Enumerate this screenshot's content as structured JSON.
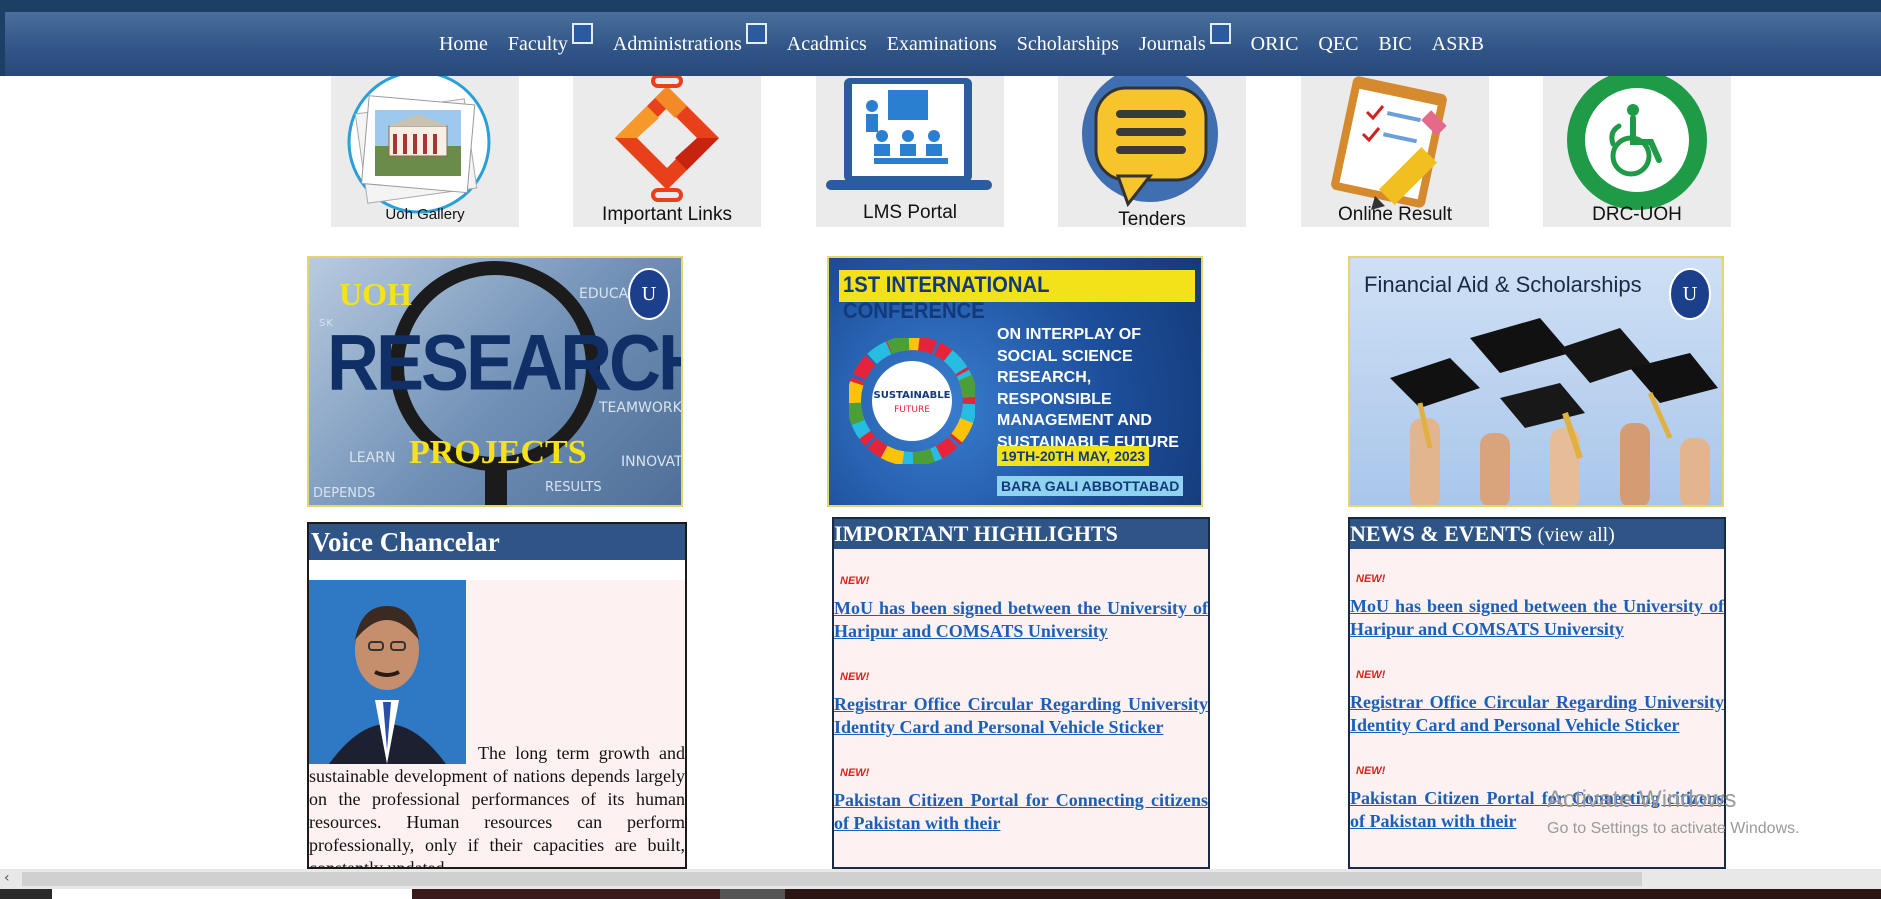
{
  "nav": {
    "items": [
      "Home",
      "Faculty",
      "Administrations",
      "Acadmics",
      "Examinations",
      "Scholarships",
      "Journals",
      "ORIC",
      "QEC",
      "BIC",
      "ASRB"
    ]
  },
  "quick_links": [
    "Uoh Gallery",
    "Important Links",
    "LMS Portal",
    "Tenders",
    "Online Result",
    "DRC-UOH"
  ],
  "banners": {
    "research": {
      "top": "UOH",
      "main": "RESEARCH",
      "sub": "PROJECTS",
      "words": [
        "EDUCA",
        "TEAMWORK",
        "LEARN",
        "INNOVAT",
        "RESULTS",
        "DEPENDS",
        "SK"
      ]
    },
    "conference": {
      "title": "1ST INTERNATIONAL CONFERENCE",
      "body": [
        "ON INTERPLAY OF",
        "SOCIAL SCIENCE",
        "RESEARCH, RESPONSIBLE",
        "MANAGEMENT AND",
        "SUSTAINABLE FUTURE"
      ],
      "date": "19TH-20TH MAY, 2023",
      "place": "BARA GALI ABBOTTABAD",
      "wheel_center": "SUSTAINABLE",
      "wheel_center2": "FUTURE"
    },
    "financial": {
      "title": "Financial Aid & Scholarships"
    }
  },
  "voice": {
    "title": "Voice Chancelar",
    "text": "The long term growth and sustainable development of nations depends largely on the professional performances of its human resources. Human resources can perform professionally, only if their capacities are built, constantly updated"
  },
  "highlights": {
    "title": "IMPORTANT HIGHLIGHTS",
    "badge": "NEW!",
    "items": [
      "MoU has been signed between the University of Haripur and COMSATS University",
      "Registrar Office Circular Regarding University Identity Card and Personal Vehicle Sticker",
      "Pakistan Citizen Portal for Connecting citizens of Pakistan with their"
    ]
  },
  "news": {
    "title": "NEWS & EVENTS",
    "view_all": "(view all)",
    "badge": "NEW!",
    "items": [
      "MoU has been signed between the University of Haripur and COMSATS University",
      "Registrar Office Circular Regarding University Identity Card and Personal Vehicle Sticker",
      "Pakistan Citizen Portal for Connecting citizens of Pakistan with their"
    ]
  },
  "watermark": {
    "title": "Activate Windows",
    "sub": "Go to Settings to activate Windows."
  }
}
